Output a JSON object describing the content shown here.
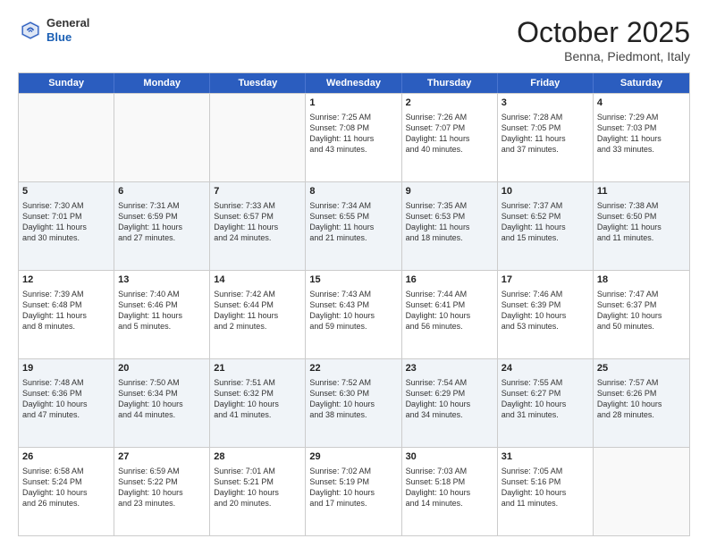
{
  "header": {
    "logo_general": "General",
    "logo_blue": "Blue",
    "month": "October 2025",
    "location": "Benna, Piedmont, Italy"
  },
  "days_of_week": [
    "Sunday",
    "Monday",
    "Tuesday",
    "Wednesday",
    "Thursday",
    "Friday",
    "Saturday"
  ],
  "rows": [
    {
      "alt": false,
      "cells": [
        {
          "day": "",
          "lines": []
        },
        {
          "day": "",
          "lines": []
        },
        {
          "day": "",
          "lines": []
        },
        {
          "day": "1",
          "lines": [
            "Sunrise: 7:25 AM",
            "Sunset: 7:08 PM",
            "Daylight: 11 hours",
            "and 43 minutes."
          ]
        },
        {
          "day": "2",
          "lines": [
            "Sunrise: 7:26 AM",
            "Sunset: 7:07 PM",
            "Daylight: 11 hours",
            "and 40 minutes."
          ]
        },
        {
          "day": "3",
          "lines": [
            "Sunrise: 7:28 AM",
            "Sunset: 7:05 PM",
            "Daylight: 11 hours",
            "and 37 minutes."
          ]
        },
        {
          "day": "4",
          "lines": [
            "Sunrise: 7:29 AM",
            "Sunset: 7:03 PM",
            "Daylight: 11 hours",
            "and 33 minutes."
          ]
        }
      ]
    },
    {
      "alt": true,
      "cells": [
        {
          "day": "5",
          "lines": [
            "Sunrise: 7:30 AM",
            "Sunset: 7:01 PM",
            "Daylight: 11 hours",
            "and 30 minutes."
          ]
        },
        {
          "day": "6",
          "lines": [
            "Sunrise: 7:31 AM",
            "Sunset: 6:59 PM",
            "Daylight: 11 hours",
            "and 27 minutes."
          ]
        },
        {
          "day": "7",
          "lines": [
            "Sunrise: 7:33 AM",
            "Sunset: 6:57 PM",
            "Daylight: 11 hours",
            "and 24 minutes."
          ]
        },
        {
          "day": "8",
          "lines": [
            "Sunrise: 7:34 AM",
            "Sunset: 6:55 PM",
            "Daylight: 11 hours",
            "and 21 minutes."
          ]
        },
        {
          "day": "9",
          "lines": [
            "Sunrise: 7:35 AM",
            "Sunset: 6:53 PM",
            "Daylight: 11 hours",
            "and 18 minutes."
          ]
        },
        {
          "day": "10",
          "lines": [
            "Sunrise: 7:37 AM",
            "Sunset: 6:52 PM",
            "Daylight: 11 hours",
            "and 15 minutes."
          ]
        },
        {
          "day": "11",
          "lines": [
            "Sunrise: 7:38 AM",
            "Sunset: 6:50 PM",
            "Daylight: 11 hours",
            "and 11 minutes."
          ]
        }
      ]
    },
    {
      "alt": false,
      "cells": [
        {
          "day": "12",
          "lines": [
            "Sunrise: 7:39 AM",
            "Sunset: 6:48 PM",
            "Daylight: 11 hours",
            "and 8 minutes."
          ]
        },
        {
          "day": "13",
          "lines": [
            "Sunrise: 7:40 AM",
            "Sunset: 6:46 PM",
            "Daylight: 11 hours",
            "and 5 minutes."
          ]
        },
        {
          "day": "14",
          "lines": [
            "Sunrise: 7:42 AM",
            "Sunset: 6:44 PM",
            "Daylight: 11 hours",
            "and 2 minutes."
          ]
        },
        {
          "day": "15",
          "lines": [
            "Sunrise: 7:43 AM",
            "Sunset: 6:43 PM",
            "Daylight: 10 hours",
            "and 59 minutes."
          ]
        },
        {
          "day": "16",
          "lines": [
            "Sunrise: 7:44 AM",
            "Sunset: 6:41 PM",
            "Daylight: 10 hours",
            "and 56 minutes."
          ]
        },
        {
          "day": "17",
          "lines": [
            "Sunrise: 7:46 AM",
            "Sunset: 6:39 PM",
            "Daylight: 10 hours",
            "and 53 minutes."
          ]
        },
        {
          "day": "18",
          "lines": [
            "Sunrise: 7:47 AM",
            "Sunset: 6:37 PM",
            "Daylight: 10 hours",
            "and 50 minutes."
          ]
        }
      ]
    },
    {
      "alt": true,
      "cells": [
        {
          "day": "19",
          "lines": [
            "Sunrise: 7:48 AM",
            "Sunset: 6:36 PM",
            "Daylight: 10 hours",
            "and 47 minutes."
          ]
        },
        {
          "day": "20",
          "lines": [
            "Sunrise: 7:50 AM",
            "Sunset: 6:34 PM",
            "Daylight: 10 hours",
            "and 44 minutes."
          ]
        },
        {
          "day": "21",
          "lines": [
            "Sunrise: 7:51 AM",
            "Sunset: 6:32 PM",
            "Daylight: 10 hours",
            "and 41 minutes."
          ]
        },
        {
          "day": "22",
          "lines": [
            "Sunrise: 7:52 AM",
            "Sunset: 6:30 PM",
            "Daylight: 10 hours",
            "and 38 minutes."
          ]
        },
        {
          "day": "23",
          "lines": [
            "Sunrise: 7:54 AM",
            "Sunset: 6:29 PM",
            "Daylight: 10 hours",
            "and 34 minutes."
          ]
        },
        {
          "day": "24",
          "lines": [
            "Sunrise: 7:55 AM",
            "Sunset: 6:27 PM",
            "Daylight: 10 hours",
            "and 31 minutes."
          ]
        },
        {
          "day": "25",
          "lines": [
            "Sunrise: 7:57 AM",
            "Sunset: 6:26 PM",
            "Daylight: 10 hours",
            "and 28 minutes."
          ]
        }
      ]
    },
    {
      "alt": false,
      "cells": [
        {
          "day": "26",
          "lines": [
            "Sunrise: 6:58 AM",
            "Sunset: 5:24 PM",
            "Daylight: 10 hours",
            "and 26 minutes."
          ]
        },
        {
          "day": "27",
          "lines": [
            "Sunrise: 6:59 AM",
            "Sunset: 5:22 PM",
            "Daylight: 10 hours",
            "and 23 minutes."
          ]
        },
        {
          "day": "28",
          "lines": [
            "Sunrise: 7:01 AM",
            "Sunset: 5:21 PM",
            "Daylight: 10 hours",
            "and 20 minutes."
          ]
        },
        {
          "day": "29",
          "lines": [
            "Sunrise: 7:02 AM",
            "Sunset: 5:19 PM",
            "Daylight: 10 hours",
            "and 17 minutes."
          ]
        },
        {
          "day": "30",
          "lines": [
            "Sunrise: 7:03 AM",
            "Sunset: 5:18 PM",
            "Daylight: 10 hours",
            "and 14 minutes."
          ]
        },
        {
          "day": "31",
          "lines": [
            "Sunrise: 7:05 AM",
            "Sunset: 5:16 PM",
            "Daylight: 10 hours",
            "and 11 minutes."
          ]
        },
        {
          "day": "",
          "lines": []
        }
      ]
    }
  ]
}
